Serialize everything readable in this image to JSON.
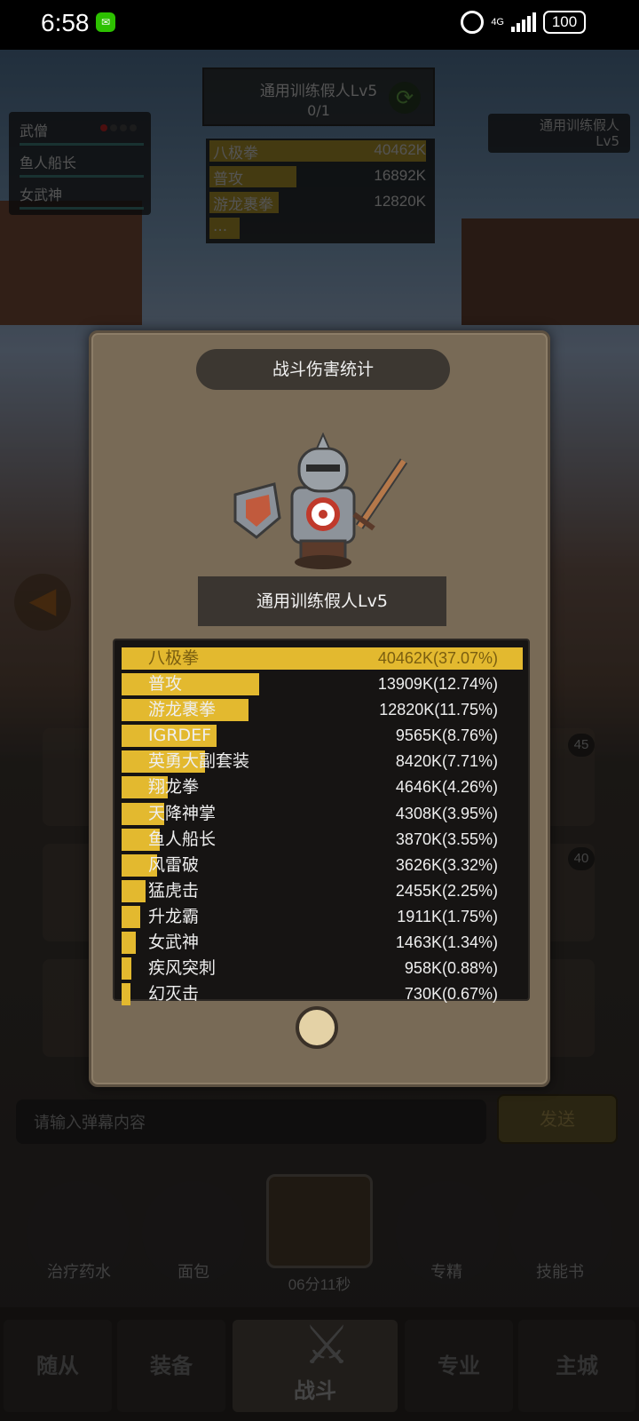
{
  "status_bar": {
    "time": "6:58",
    "network": "4G",
    "battery": "100"
  },
  "hud": {
    "enemy_name": "通用训练假人Lv5",
    "enemy_count": "0/1",
    "target_name": "通用训练假人",
    "target_level": "Lv5",
    "team": [
      "武僧",
      "鱼人船长",
      "女武神"
    ],
    "mini_damage": [
      {
        "name": "八极拳",
        "value": "40462K",
        "pct": 100
      },
      {
        "name": "普攻",
        "value": "16892K",
        "pct": 40
      },
      {
        "name": "游龙裹拳",
        "value": "12820K",
        "pct": 32
      },
      {
        "name": "...",
        "value": "",
        "pct": 14
      }
    ]
  },
  "background": {
    "chat_placeholder": "请输入弹幕内容",
    "send_label": "发送",
    "level_badges": [
      "45",
      "40"
    ],
    "items": [
      "治疗药水",
      "面包",
      "专精",
      "技能书"
    ],
    "timer": "06分11秒",
    "nav": [
      "随从",
      "装备",
      "战斗",
      "专业",
      "主城"
    ]
  },
  "modal": {
    "title": "战斗伤害统计",
    "boss_name": "通用训练假人Lv5",
    "stats": [
      {
        "name": "八极拳",
        "value": "40462K(37.07%)",
        "pct": 37.07
      },
      {
        "name": "普攻",
        "value": "13909K(12.74%)",
        "pct": 12.74
      },
      {
        "name": "游龙裹拳",
        "value": "12820K(11.75%)",
        "pct": 11.75
      },
      {
        "name": "IGRDEF",
        "value": "9565K(8.76%)",
        "pct": 8.76
      },
      {
        "name": "英勇大副套装",
        "value": "8420K(7.71%)",
        "pct": 7.71
      },
      {
        "name": "翔龙拳",
        "value": "4646K(4.26%)",
        "pct": 4.26
      },
      {
        "name": "天降神掌",
        "value": "4308K(3.95%)",
        "pct": 3.95
      },
      {
        "name": "鱼人船长",
        "value": "3870K(3.55%)",
        "pct": 3.55
      },
      {
        "name": "风雷破",
        "value": "3626K(3.32%)",
        "pct": 3.32
      },
      {
        "name": "猛虎击",
        "value": "2455K(2.25%)",
        "pct": 2.25
      },
      {
        "name": "升龙霸",
        "value": "1911K(1.75%)",
        "pct": 1.75
      },
      {
        "name": "女武神",
        "value": "1463K(1.34%)",
        "pct": 1.34
      },
      {
        "name": "疾风突刺",
        "value": "958K(0.88%)",
        "pct": 0.88
      },
      {
        "name": "幻灭击",
        "value": "730K(0.67%)",
        "pct": 0.67
      }
    ]
  },
  "colors": {
    "bar": "#e3b92f",
    "panel": "#161413",
    "modal": "#786a56"
  }
}
